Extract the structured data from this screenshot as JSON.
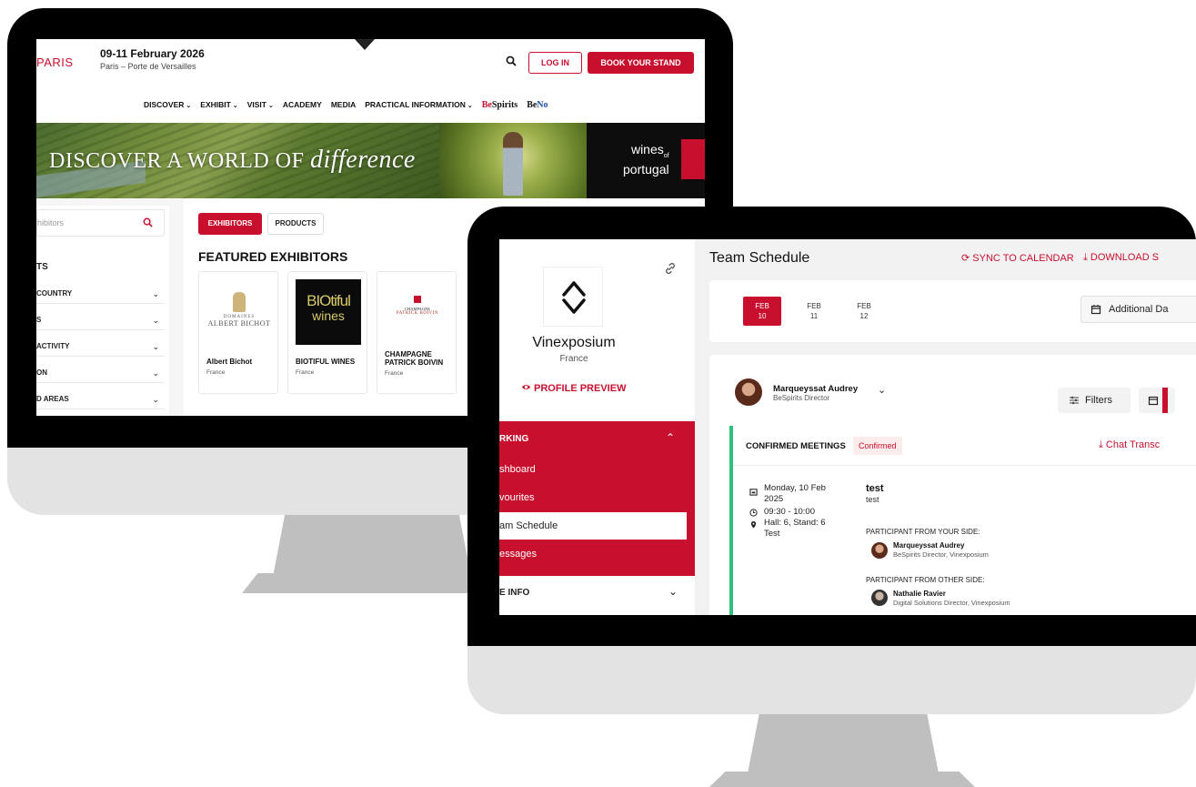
{
  "back_screen": {
    "logo_text": "PARIS",
    "event_date": "09-11 February 2026",
    "event_place": "Paris – Porte de Versailles",
    "header_buttons": {
      "login": "LOG IN",
      "book": "BOOK YOUR STAND"
    },
    "nav": [
      {
        "label": "DISCOVER",
        "dropdown": true
      },
      {
        "label": "EXHIBIT",
        "dropdown": true
      },
      {
        "label": "VISIT",
        "dropdown": true
      },
      {
        "label": "ACADEMY",
        "dropdown": false
      },
      {
        "label": "MEDIA",
        "dropdown": false
      },
      {
        "label": "PRACTICAL INFORMATION",
        "dropdown": true
      }
    ],
    "nav_brand": "BeSpirits",
    "nav_brand2": "BeNo",
    "banner": {
      "headline": "DISCOVER A WORLD OF",
      "headline_script": "difference",
      "brand": "wines of portugal",
      "brand_line1": "wines",
      "brand_of": "of",
      "brand_line2": "portugal"
    },
    "search": {
      "placeholder": "hibitors"
    },
    "filters_title": "TS",
    "filters": [
      {
        "label": "COUNTRY"
      },
      {
        "label": "S"
      },
      {
        "label": "ACTIVITY"
      },
      {
        "label": "ON"
      },
      {
        "label": "D AREAS"
      }
    ],
    "tabs": {
      "exhibitors": "EXHIBITORS",
      "products": "PRODUCTS"
    },
    "featured_title": "FEATURED EXHIBITORS",
    "exhibitors": [
      {
        "name": "Albert Bichot",
        "country": "France",
        "logo_text1": "DOMAINES",
        "logo_text2": "ALBERT BICHOT"
      },
      {
        "name": "BIOTIFUL WINES",
        "country": "France",
        "logo_text1": "BIOtiful",
        "logo_text2": "wines"
      },
      {
        "name": "CHAMPAGNE PATRICK BOIVIN",
        "name_l1": "CHAMPAGNE",
        "name_l2": "PATRICK BOIVIN",
        "country": "France",
        "logo_text1": "CHAMPAGNE",
        "logo_text2": "PATRICK BOIVIN"
      }
    ]
  },
  "front_screen": {
    "profile": {
      "name": "Vinexposium",
      "country": "France",
      "preview_label": "PROFILE PREVIEW"
    },
    "networking": {
      "heading": "RKING",
      "items": [
        {
          "label": "shboard"
        },
        {
          "label": "vourites"
        },
        {
          "label": "am Schedule",
          "active": true
        },
        {
          "label": "essages"
        }
      ]
    },
    "info_section": "E INFO",
    "page_title": "Team Schedule",
    "actions": {
      "sync": "SYNC TO CALENDAR",
      "download": "DOWNLOAD S"
    },
    "dates": [
      {
        "month": "FEB",
        "day": "10",
        "active": true
      },
      {
        "month": "FEB",
        "day": "11",
        "active": false
      },
      {
        "month": "FEB",
        "day": "12",
        "active": false
      }
    ],
    "additional_days": "Additional Da",
    "user": {
      "name": "Marqueyssat Audrey",
      "role": "BeSpirits Director"
    },
    "filters_label": "Filters",
    "meetings": {
      "title": "CONFIRMED MEETINGS",
      "badge": "Confirmed",
      "chat": "Chat Transc",
      "item": {
        "date_line1": "Monday, 10 Feb",
        "date_line2": "2025",
        "time": "09:30 - 10:00",
        "location_line1": "Hall: 6, Stand: 6",
        "location_line2": "Test",
        "title": "test",
        "subtitle": "test",
        "your_side_label": "PARTICIPANT FROM YOUR SIDE:",
        "your_side": {
          "name": "Marqueyssat Audrey",
          "role": "BeSpirits Director, Vinexposium"
        },
        "other_side_label": "PARTICIPANT FROM OTHER SIDE:",
        "other_side": {
          "name": "Nathalie Ravier",
          "role": "Digital Solutions Director, Vinexposium"
        }
      }
    }
  },
  "colors": {
    "brand_red": "#c8102e",
    "confirmed_green": "#2ec27e",
    "bezel": "#000000",
    "stand": "#bfbfbf"
  }
}
